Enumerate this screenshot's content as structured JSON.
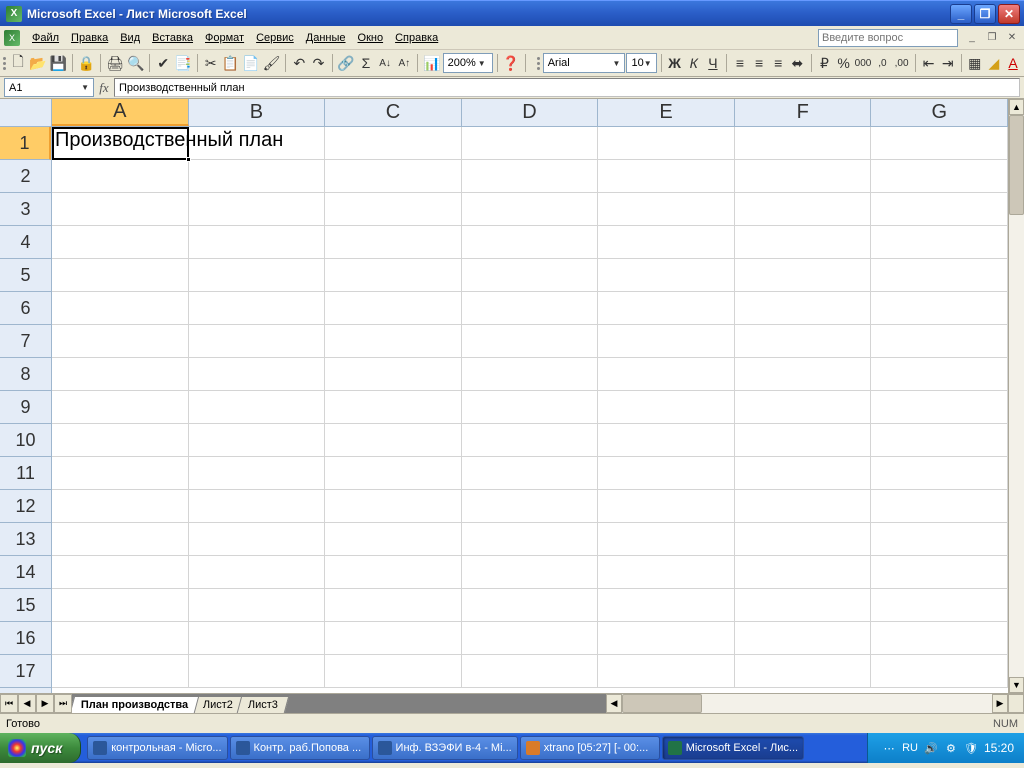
{
  "titlebar": {
    "title": "Microsoft Excel - Лист Microsoft Excel"
  },
  "menu": {
    "items": [
      "Файл",
      "Правка",
      "Вид",
      "Вставка",
      "Формат",
      "Сервис",
      "Данные",
      "Окно",
      "Справка"
    ],
    "ask_placeholder": "Введите вопрос"
  },
  "toolbar1": {
    "zoom": "200%"
  },
  "toolbar2": {
    "font_name": "Arial",
    "font_size": "10"
  },
  "formula": {
    "name_box": "A1",
    "fx": "fx",
    "content": "Производственный план"
  },
  "sheet": {
    "columns": [
      "A",
      "B",
      "C",
      "D",
      "E",
      "F",
      "G"
    ],
    "rows": [
      "1",
      "2",
      "3",
      "4",
      "5",
      "6",
      "7",
      "8",
      "9",
      "10",
      "11",
      "12",
      "13",
      "14",
      "15",
      "16",
      "17"
    ],
    "a1_value": "Производственный план",
    "active_col": "A",
    "active_row": "1"
  },
  "tabs": {
    "items": [
      "План производства",
      "Лист2",
      "Лист3"
    ],
    "active": 0
  },
  "status": {
    "ready": "Готово",
    "num": "NUM"
  },
  "taskbar": {
    "start": "пуск",
    "items": [
      {
        "label": "контрольная - Micro...",
        "color": "#2b579a"
      },
      {
        "label": "Контр. раб.Попова ...",
        "color": "#2b579a"
      },
      {
        "label": "Инф. ВЗЭФИ в-4 - Mi...",
        "color": "#2b579a"
      },
      {
        "label": "xtrano [05:27] [- 00:...",
        "color": "#d97b29"
      },
      {
        "label": "Microsoft Excel - Лис...",
        "color": "#217346",
        "active": true
      }
    ],
    "lang": "RU",
    "clock": "15:20"
  }
}
